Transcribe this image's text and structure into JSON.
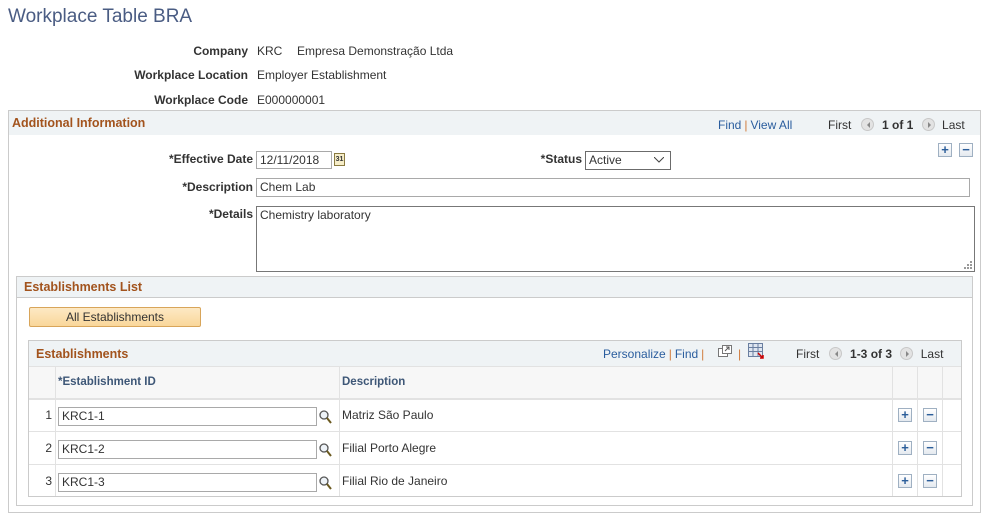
{
  "page": {
    "title": "Workplace Table BRA"
  },
  "keys": {
    "company_label": "Company",
    "company_code": "KRC",
    "company_name": "Empresa Demonstração Ltda",
    "location_label": "Workplace Location",
    "location_value": "Employer Establishment",
    "code_label": "Workplace Code",
    "code_value": "E000000001"
  },
  "additional": {
    "title": "Additional Information",
    "find": "Find",
    "sep": "|",
    "view_all": "View All",
    "first": "First",
    "range": "1 of 1",
    "last": "Last",
    "effective_date_label": "*Effective Date",
    "effective_date": "12/11/2018",
    "calendar_icon_text": "31",
    "status_label": "*Status",
    "status": "Active",
    "description_label": "*Description",
    "description": "Chem Lab",
    "details_label": "*Details",
    "details": "Chemistry laboratory",
    "add": "+",
    "remove": "−"
  },
  "est_list": {
    "title": "Establishments List",
    "all_button": "All Establishments",
    "grid": {
      "title": "Establishments",
      "personalize": "Personalize",
      "find": "Find",
      "sep": "|",
      "first": "First",
      "range": "1-3 of 3",
      "last": "Last",
      "columns": [
        "*Establishment ID",
        "Description"
      ],
      "rows": [
        {
          "num": "1",
          "id": "KRC1-1",
          "desc": "Matriz São Paulo"
        },
        {
          "num": "2",
          "id": "KRC1-2",
          "desc": "Filial Porto Alegre"
        },
        {
          "num": "3",
          "id": "KRC1-3",
          "desc": "Filial Rio de Janeiro"
        }
      ],
      "add": "+",
      "remove": "−"
    }
  }
}
